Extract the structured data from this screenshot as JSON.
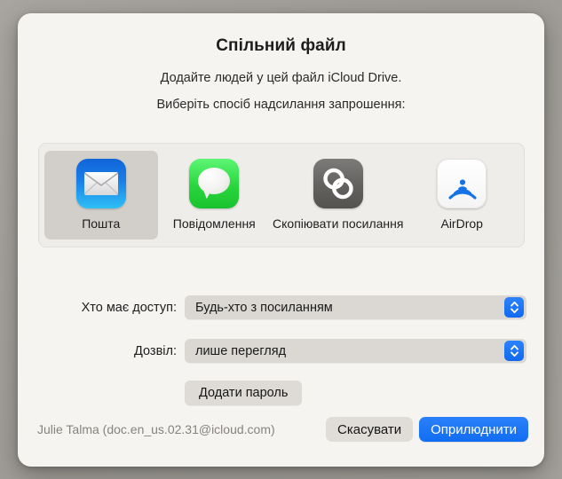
{
  "dialog": {
    "title": "Спільний файл",
    "subtitle": "Додайте людей у цей файл iCloud Drive.",
    "subtitle2": "Виберіть спосіб надсилання запрошення:"
  },
  "share_methods": [
    {
      "label": "Пошта",
      "icon": "mail-icon",
      "selected": true
    },
    {
      "label": "Повідомлення",
      "icon": "messages-icon",
      "selected": false
    },
    {
      "label": "Скопіювати посилання",
      "icon": "link-icon",
      "selected": false
    },
    {
      "label": "AirDrop",
      "icon": "airdrop-icon",
      "selected": false
    }
  ],
  "options": {
    "access": {
      "label": "Хто має доступ:",
      "value": "Будь-хто з посиланням"
    },
    "permission": {
      "label": "Дозвіл:",
      "value": "лише перегляд"
    }
  },
  "password_button": "Додати пароль",
  "footer": {
    "account": "Julie Talma (doc.en_us.02.31@icloud.com)",
    "cancel": "Скасувати",
    "publish": "Оприлюднити"
  },
  "colors": {
    "dialog_background": "#f6f4f1",
    "backdrop": "#a5a29d",
    "accent_blue": "#1169f0",
    "panel_background": "#efedea",
    "selected_tile": "#d2cfcb",
    "control_background": "#dbd8d4",
    "muted_text": "#86837f"
  }
}
